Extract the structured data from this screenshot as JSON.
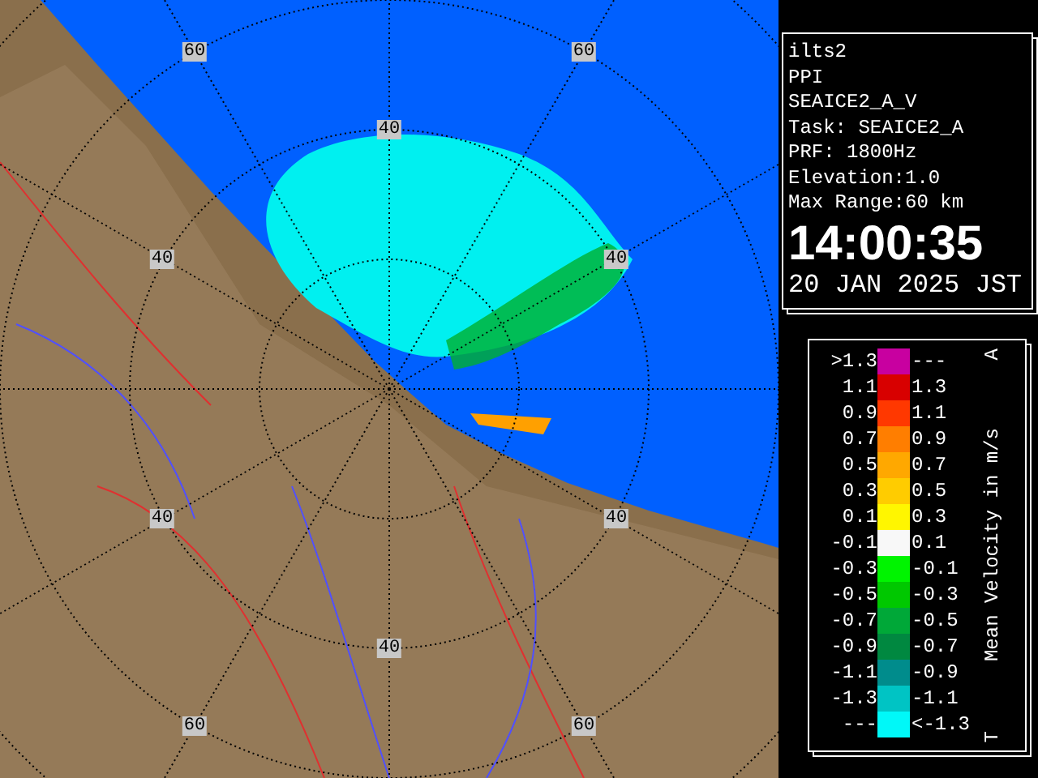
{
  "radar_image": {
    "range_labels": [
      "60",
      "60",
      "40",
      "40",
      "40",
      "40",
      "40",
      "40",
      "60",
      "60"
    ]
  },
  "info": {
    "lines": [
      "ilts2",
      "PPI",
      "SEAICE2_A_V",
      "Task: SEAICE2_A",
      "PRF: 1800Hz",
      "Elevation:1.0",
      "Max Range:60 km"
    ],
    "time": "14:00:35",
    "date": "20 JAN 2025 JST"
  },
  "legend": {
    "title": "Mean Velocity in m/s",
    "top_mark": "A",
    "bottom_mark": "T",
    "rows": [
      {
        "low": ">1.3",
        "high": "---",
        "color": "#c800a0"
      },
      {
        "low": "1.1",
        "high": "1.3",
        "color": "#d80000"
      },
      {
        "low": "0.9",
        "high": "1.1",
        "color": "#ff3800"
      },
      {
        "low": "0.7",
        "high": "0.9",
        "color": "#ff7e00"
      },
      {
        "low": "0.5",
        "high": "0.7",
        "color": "#ffa800"
      },
      {
        "low": "0.3",
        "high": "0.5",
        "color": "#ffcc00"
      },
      {
        "low": "0.1",
        "high": "0.3",
        "color": "#fff600"
      },
      {
        "low": "-0.1",
        "high": "0.1",
        "color": "#f8f8f8"
      },
      {
        "low": "-0.3",
        "high": "-0.1",
        "color": "#00f400"
      },
      {
        "low": "-0.5",
        "high": "-0.3",
        "color": "#00c800"
      },
      {
        "low": "-0.7",
        "high": "-0.5",
        "color": "#00a838"
      },
      {
        "low": "-0.9",
        "high": "-0.7",
        "color": "#008840"
      },
      {
        "low": "-1.1",
        "high": "-0.9",
        "color": "#008c8c"
      },
      {
        "low": "-1.3",
        "high": "-1.1",
        "color": "#00c4c4"
      },
      {
        "low": "---",
        "high": "<-1.3",
        "color": "#00f8f8"
      }
    ]
  }
}
